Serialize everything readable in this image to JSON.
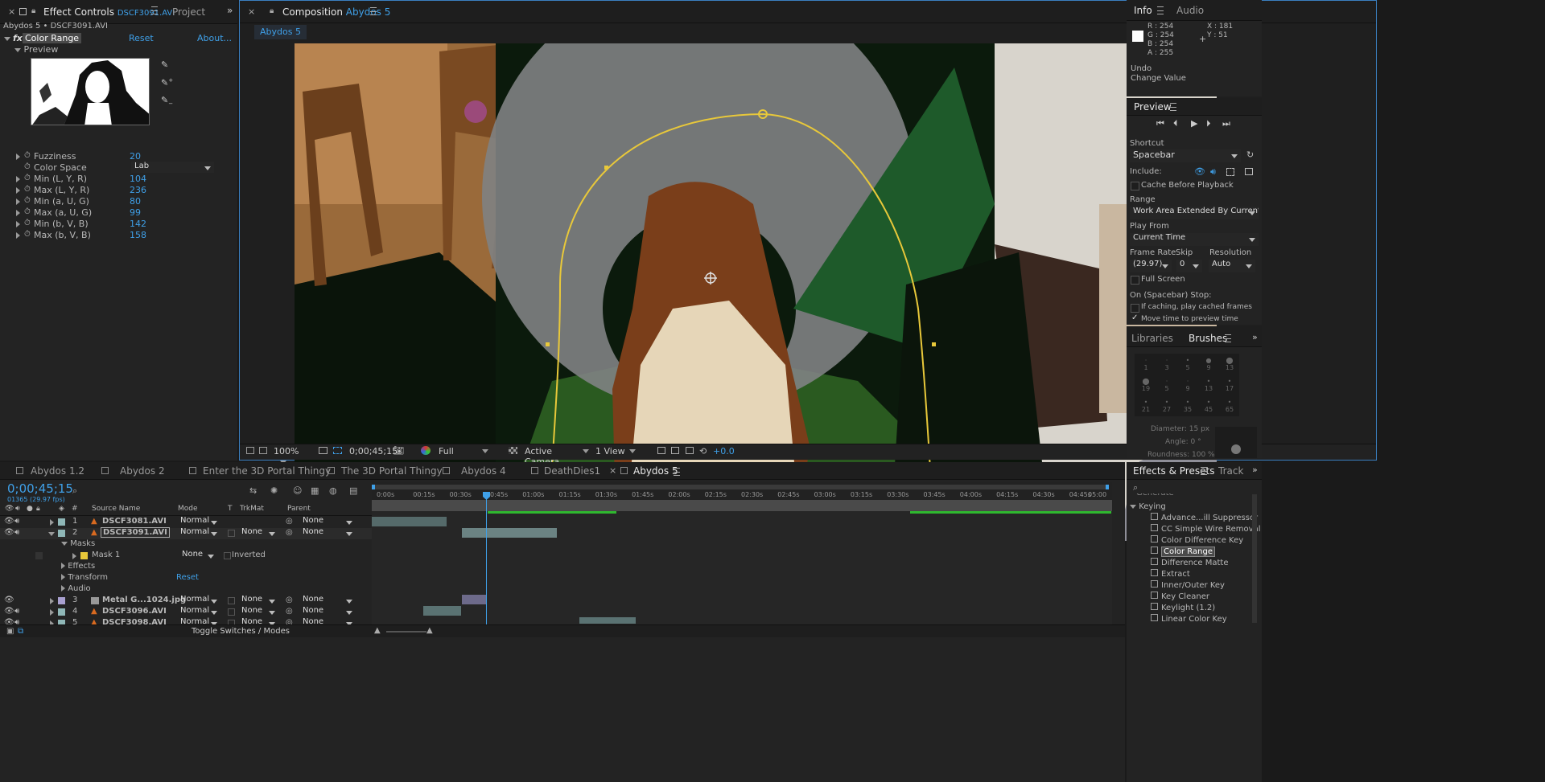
{
  "effect_controls": {
    "tab_label": "Effect Controls",
    "tab_file": "DSCF3091.AVI",
    "project_tab": "Project",
    "breadcrumb": "Abydos 5 • DSCF3091.AVI",
    "effect_name": "Color Range",
    "reset": "Reset",
    "about": "About...",
    "preview_label": "Preview",
    "params": [
      {
        "name": "Fuzziness",
        "value": "20"
      },
      {
        "name": "Color Space",
        "value": "Lab"
      },
      {
        "name": "Min (L, Y, R)",
        "value": "104"
      },
      {
        "name": "Max (L, Y, R)",
        "value": "236"
      },
      {
        "name": "Min (a, U, G)",
        "value": "80"
      },
      {
        "name": "Max (a, U, G)",
        "value": "99"
      },
      {
        "name": "Min (b, V, B)",
        "value": "142"
      },
      {
        "name": "Max (b, V, B)",
        "value": "158"
      }
    ]
  },
  "composition": {
    "tab_label": "Composition",
    "tab_name": "Abydos 5",
    "sub_tab": "Abydos 5",
    "footer": {
      "zoom": "100%",
      "timecode": "0;00;45;15",
      "resolution": "Full",
      "camera": "Active Camera",
      "views": "1 View",
      "exposure": "+0.0"
    }
  },
  "info": {
    "tab": "Info",
    "audio_tab": "Audio",
    "r": "R : 254",
    "g": "G : 254",
    "b": "B : 254",
    "a": "A : 255",
    "x": "X : 181",
    "y": "Y : 51",
    "undo": "Undo",
    "change": "Change Value"
  },
  "preview": {
    "title": "Preview",
    "shortcut_label": "Shortcut",
    "shortcut": "Spacebar",
    "include_label": "Include:",
    "cache": "Cache Before Playback",
    "range_label": "Range",
    "range": "Work Area Extended By Current Ti",
    "play_from_label": "Play From",
    "play_from": "Current Time",
    "frame_rate_label": "Frame Rate",
    "skip_label": "Skip",
    "resolution_label": "Resolution",
    "frame_rate": "(29.97)",
    "skip": "0",
    "resolution": "Auto",
    "full_screen": "Full Screen",
    "stop_label": "On (Spacebar) Stop:",
    "if_caching": "If caching, play cached frames",
    "move_time": "Move time to preview time"
  },
  "brushes": {
    "libraries_tab": "Libraries",
    "brushes_tab": "Brushes",
    "sizes": [
      "1",
      "3",
      "5",
      "9",
      "13",
      "19",
      "5",
      "9",
      "13",
      "17",
      "21",
      "27",
      "35",
      "45",
      "65"
    ],
    "diameter": "Diameter: 15 px",
    "angle": "Angle: 0 °",
    "roundness": "Roundness: 100 %"
  },
  "effects_presets": {
    "tab": "Effects & Presets",
    "track_tab": "Track",
    "category_above": "Generate",
    "category": "Keying",
    "items": [
      "Advance...ill Suppressor",
      "CC Simple Wire Removal",
      "Color Difference Key",
      "Color Range",
      "Difference Matte",
      "Extract",
      "Inner/Outer Key",
      "Key Cleaner",
      "Keylight (1.2)",
      "Linear Color Key"
    ]
  },
  "timeline": {
    "tabs": [
      "Abydos 1.2",
      "Abydos 2",
      "Enter the 3D Portal Thingy",
      "The 3D Portal Thingy",
      "Abydos 4",
      "DeathDies1",
      "Abydos 5"
    ],
    "timecode": "0;00;45;15",
    "frame_info": "01365 (29.97 fps)",
    "col_source": "Source Name",
    "col_mode": "Mode",
    "col_t": "T",
    "col_trkmat": "TrkMat",
    "col_parent": "Parent",
    "ruler": [
      "0:00s",
      "00:15s",
      "00:30s",
      "00:45s",
      "01:00s",
      "01:15s",
      "01:30s",
      "01:45s",
      "02:00s",
      "02:15s",
      "02:30s",
      "02:45s",
      "03:00s",
      "03:15s",
      "03:30s",
      "03:45s",
      "04:00s",
      "04:15s",
      "04:30s",
      "04:45s",
      "05:00"
    ],
    "layers": [
      {
        "num": "1",
        "name": "DSCF3081.AVI",
        "mode": "Normal",
        "trkmat": "",
        "parent": "None"
      },
      {
        "num": "2",
        "name": "DSCF3091.AVI",
        "mode": "Normal",
        "trkmat": "None",
        "parent": "None"
      },
      {
        "num": "3",
        "name": "Metal G...1024.jpg",
        "mode": "Normal",
        "trkmat": "None",
        "parent": "None"
      },
      {
        "num": "4",
        "name": "DSCF3096.AVI",
        "mode": "Normal",
        "trkmat": "None",
        "parent": "None"
      },
      {
        "num": "5",
        "name": "DSCF3098.AVI",
        "mode": "Normal",
        "trkmat": "None",
        "parent": "None"
      }
    ],
    "masks": "Masks",
    "mask1": "Mask 1",
    "mask_mode": "None",
    "inverted": "Inverted",
    "effects": "Effects",
    "transform": "Transform",
    "transform_reset": "Reset",
    "audio": "Audio",
    "toggle": "Toggle Switches / Modes"
  }
}
